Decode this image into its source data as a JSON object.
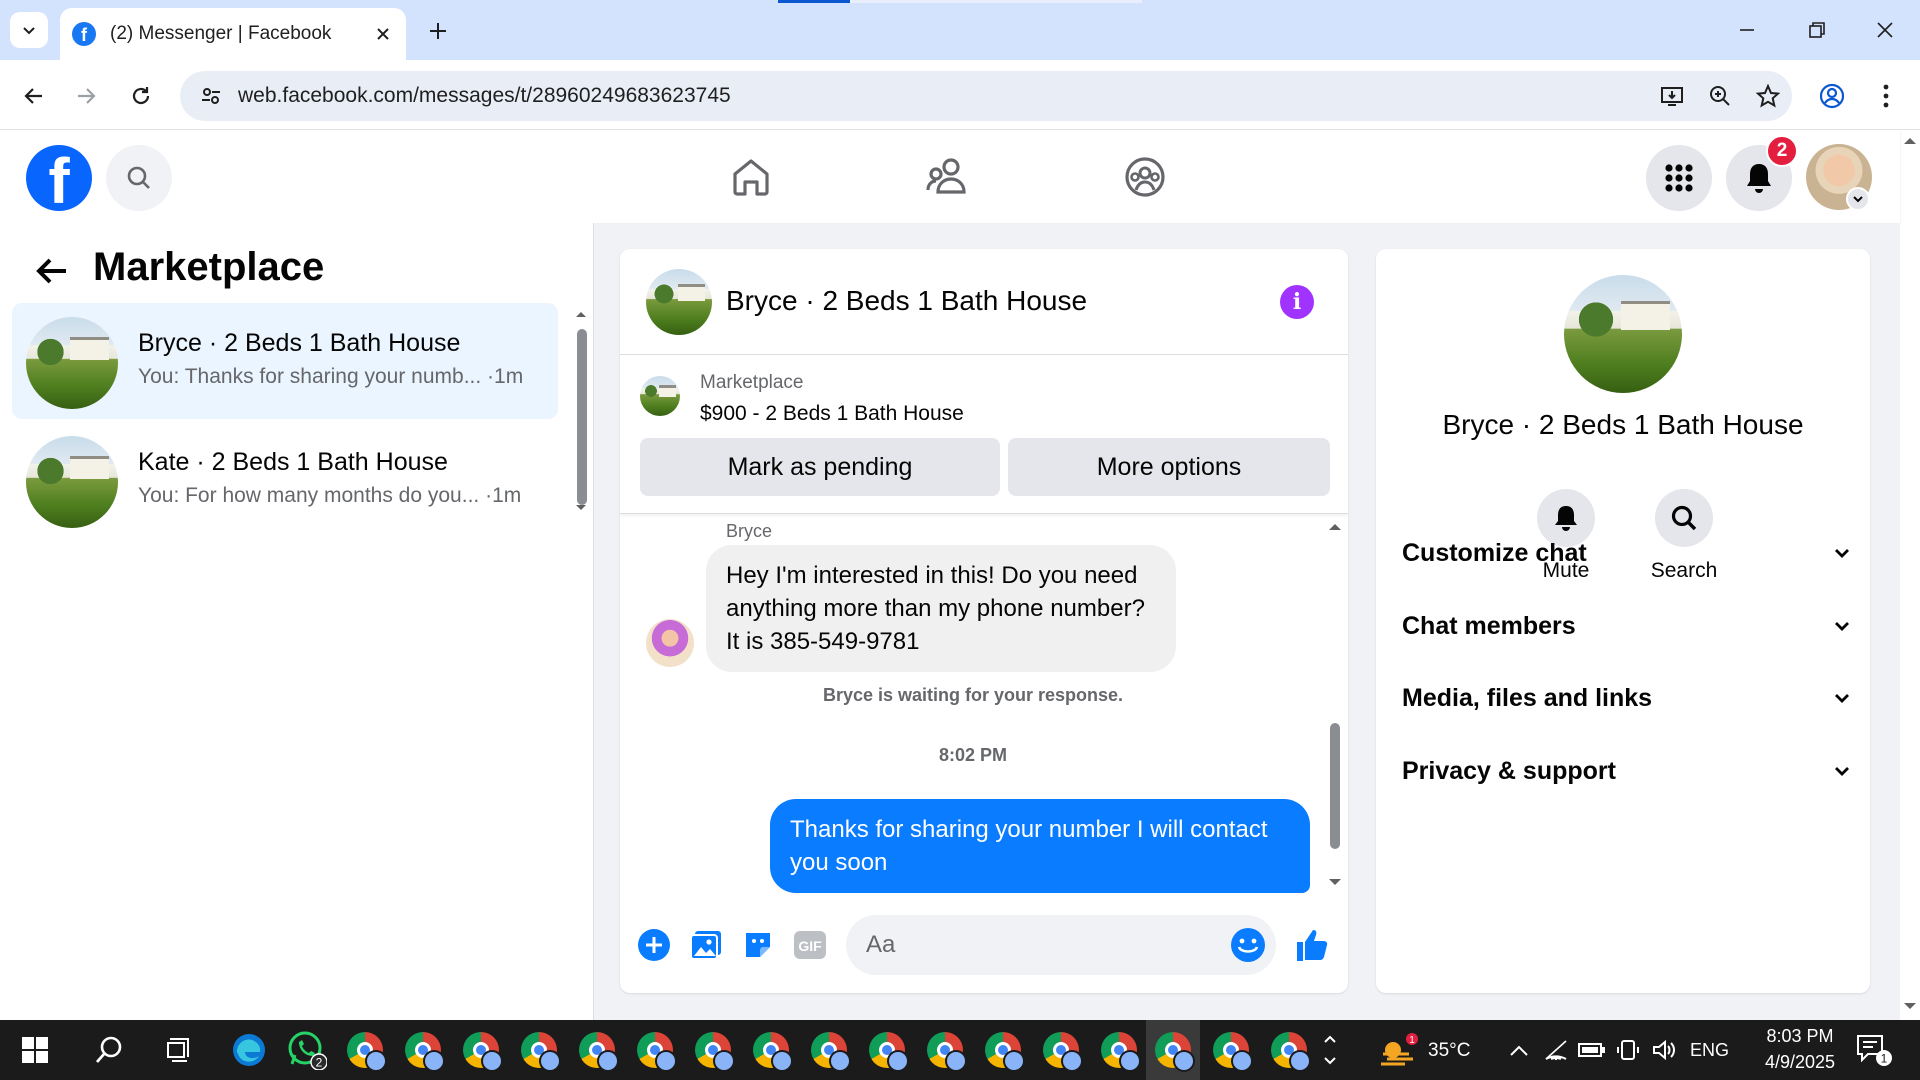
{
  "browser": {
    "tab_title": "(2) Messenger | Facebook",
    "url": "web.facebook.com/messages/t/28960249683623745"
  },
  "fb_header": {
    "notification_count": "2"
  },
  "sidebar": {
    "heading": "Marketplace",
    "conversations": [
      {
        "name": "Bryce · 2 Beds 1 Bath House",
        "preview": "You: Thanks for sharing your numb... ·1m",
        "active": true
      },
      {
        "name": "Kate · 2 Beds 1 Bath House",
        "preview": "You: For how many months do you... ·1m",
        "active": false
      }
    ]
  },
  "chat": {
    "title": "Bryce · 2 Beds 1 Bath House",
    "marketplace_label": "Marketplace",
    "listing": "$900 - 2 Beds 1 Bath House",
    "mark_pending_label": "Mark as pending",
    "more_options_label": "More options",
    "sender_name": "Bryce",
    "incoming_message": "Hey I'm interested in this! Do you need anything more than my phone number? It is 385-549-9781",
    "waiting_text": "Bryce is waiting for your response.",
    "timestamp": "8:02 PM",
    "outgoing_message": "Thanks for sharing your number I will contact you soon",
    "input_placeholder": "Aa"
  },
  "details": {
    "name": "Bryce · 2 Beds 1 Bath House",
    "mute_label": "Mute",
    "search_label": "Search",
    "sections": [
      "Customize chat",
      "Chat members",
      "Media, files and links",
      "Privacy & support"
    ]
  },
  "taskbar": {
    "weather_temp": "35°C",
    "weather_badge": "1",
    "language": "ENG",
    "time": "8:03 PM",
    "date": "4/9/2025",
    "whatsapp_badge": "2",
    "notification_badge": "1"
  },
  "colors": {
    "fb_blue": "#0866ff",
    "messenger_blue": "#0a7cff",
    "active_conv_bg": "#ebf5ff",
    "info_purple": "#a033ff",
    "badge_red": "#e41e3f"
  }
}
